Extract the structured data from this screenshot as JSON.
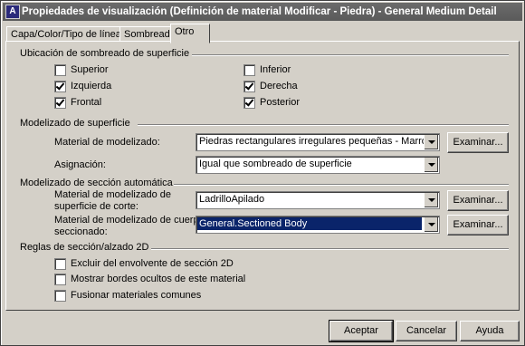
{
  "window": {
    "title": "Propiedades de visualización (Definición de material Modificar - Piedra) - General Medium Detail",
    "icon_letter": "A"
  },
  "tabs": [
    {
      "label": "Capa/Color/Tipo de línea"
    },
    {
      "label": "Sombreado"
    },
    {
      "label": "Otro"
    }
  ],
  "surface_hatch": {
    "title": "Ubicación de sombreado de superficie",
    "options": [
      {
        "label": "Superior",
        "checked": false
      },
      {
        "label": "Izquierda",
        "checked": true
      },
      {
        "label": "Frontal",
        "checked": true
      },
      {
        "label": "Inferior",
        "checked": false
      },
      {
        "label": "Derecha",
        "checked": true
      },
      {
        "label": "Posterior",
        "checked": true
      }
    ]
  },
  "surface_modeling": {
    "title": "Modelizado de superficie",
    "material_label": "Material de modelizado:",
    "material_value": "Piedras rectangulares irregulares pequeñas - Marrón",
    "assignment_label": "Asignación:",
    "assignment_value": "Igual que sombreado de superficie",
    "browse_label": "Examinar..."
  },
  "section_modeling": {
    "title": "Modelizado de sección automática",
    "cut_label_1": "Material de modelizado de",
    "cut_label_2": "superficie de corte:",
    "cut_value": "LadrilloApilado",
    "body_label_1": "Material de modelizado de cuerpo",
    "body_label_2": "seccionado:",
    "body_value": "General.Sectioned Body",
    "browse_label": "Examinar..."
  },
  "section_rules": {
    "title": "Reglas de sección/alzado 2D",
    "options": [
      {
        "label": "Excluir del envolvente de sección 2D",
        "checked": false
      },
      {
        "label": "Mostrar bordes ocultos de este material",
        "checked": false
      },
      {
        "label": "Fusionar materiales comunes",
        "checked": false
      }
    ]
  },
  "footer": {
    "ok": "Aceptar",
    "cancel": "Cancelar",
    "help": "Ayuda"
  }
}
